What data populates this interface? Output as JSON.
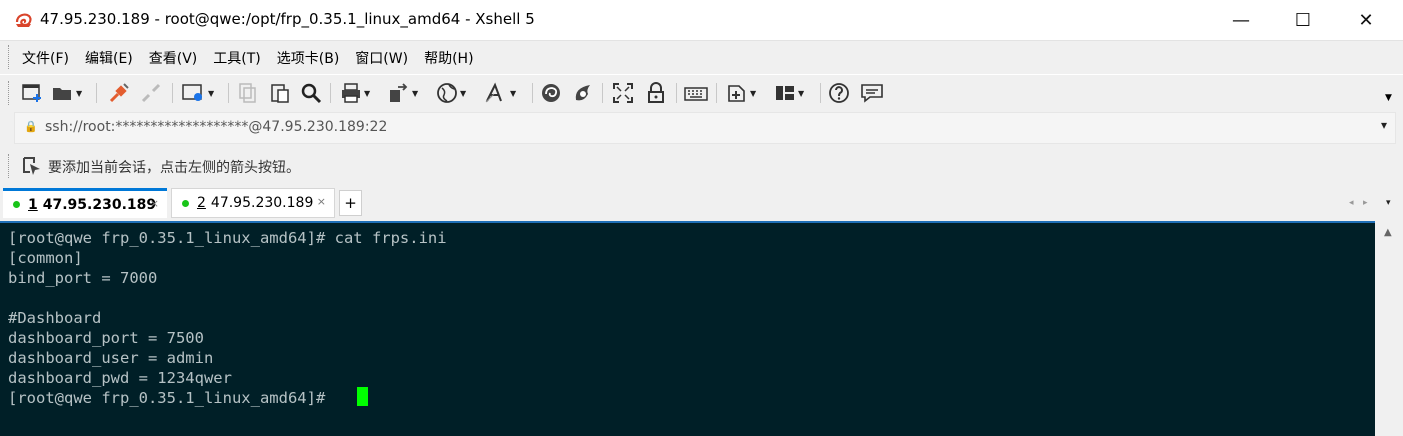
{
  "window": {
    "title": "47.95.230.189 - root@qwe:/opt/frp_0.35.1_linux_amd64 - Xshell 5",
    "minimize_glyph": "—",
    "maximize_glyph": "☐",
    "close_glyph": "✕"
  },
  "menu": [
    "文件(F)",
    "编辑(E)",
    "查看(V)",
    "工具(T)",
    "选项卡(B)",
    "窗口(W)",
    "帮助(H)"
  ],
  "toolbar": {
    "icons": [
      "new-session-icon",
      "open-folder-icon",
      "connect-icon",
      "disconnect-icon",
      "properties-icon",
      "copy-icon",
      "paste-icon",
      "find-icon",
      "print-icon",
      "transfer-icon",
      "globe-icon",
      "font-icon",
      "xftp-icon",
      "xmanager-icon",
      "fullscreen-icon",
      "lock-icon",
      "keyboard-icon",
      "add-tab-icon",
      "layout-icon",
      "help-icon",
      "chat-icon"
    ]
  },
  "address": {
    "lock_glyph": "🔒",
    "value": "ssh://root:*******************@47.95.230.189:22",
    "dropdown_glyph": "▾"
  },
  "hint": {
    "text": "要添加当前会话，点击左侧的箭头按钮。"
  },
  "tabs": [
    {
      "number": "1",
      "label": "47.95.230.189",
      "active": true,
      "status_color": "#19c419",
      "close": "×"
    },
    {
      "number": "2",
      "label": "47.95.230.189",
      "active": false,
      "status_color": "#19c419",
      "close": "×"
    }
  ],
  "tab_add": "+",
  "tab_nav": {
    "left": "◂",
    "right": "▸",
    "menu": "▾"
  },
  "terminal": {
    "background": "#001f27",
    "foreground": "#b6c2c5",
    "cursor_color": "#00ff00",
    "lines": [
      "[root@qwe frp_0.35.1_linux_amd64]# cat frps.ini",
      "[common]",
      "bind_port = 7000",
      "",
      "#Dashboard",
      "dashboard_port = 7500",
      "dashboard_user = admin",
      "dashboard_pwd = 1234qwer",
      "[root@qwe frp_0.35.1_linux_amd64]# "
    ]
  },
  "scrollbar": {
    "up_glyph": "▲"
  }
}
